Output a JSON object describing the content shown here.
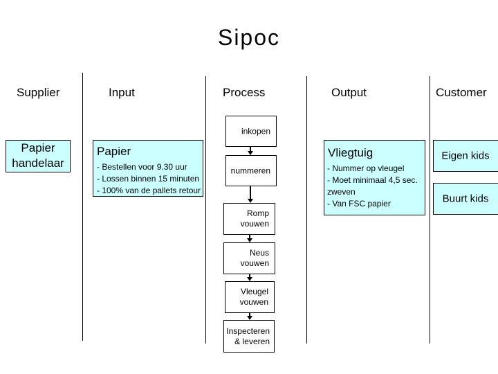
{
  "title": "Sipoc",
  "columns": {
    "supplier": "Supplier",
    "input": "Input",
    "process": "Process",
    "output": "Output",
    "customer": "Customer"
  },
  "supplier_box": {
    "lines": [
      "Papier",
      "handelaar"
    ]
  },
  "input_box": {
    "title": "Papier",
    "lines": [
      "- Bestellen voor 9.30 uur",
      "- Lossen binnen 15 minuten",
      "- 100% van de pallets retour"
    ]
  },
  "process_steps": [
    {
      "label": "inkopen"
    },
    {
      "label": "nummeren"
    },
    {
      "label": "Romp\nvouwen"
    },
    {
      "label": "Neus\nvouwen"
    },
    {
      "label": "Vleugel\nvouwen"
    },
    {
      "label": "Inspecteren\n& leveren"
    }
  ],
  "output_box": {
    "title": "Vliegtuig",
    "lines": [
      "- Nummer op vleugel",
      "- Moet minimaal 4,5 sec.",
      "zweven",
      "- Van FSC papier"
    ]
  },
  "customers": [
    {
      "label": "Eigen kids"
    },
    {
      "label": "Buurt kids"
    }
  ],
  "colors": {
    "box_fill": "#ccffff",
    "line": "#000000"
  }
}
